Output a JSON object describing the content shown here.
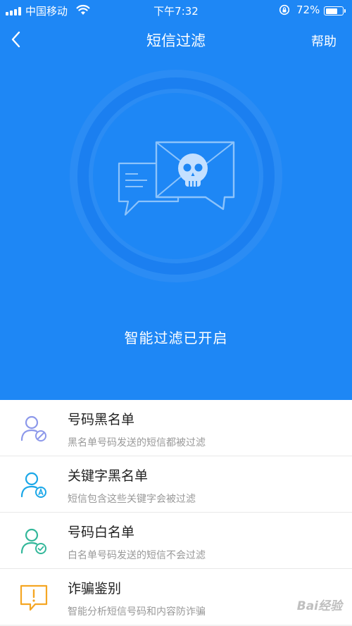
{
  "status_bar": {
    "carrier": "中国移动",
    "time": "下午7:32",
    "battery_percent": "72%",
    "battery_level": 0.72,
    "icons": [
      "signal-icon",
      "wifi-icon",
      "orientation-lock-icon",
      "battery-icon"
    ]
  },
  "nav": {
    "title": "短信过滤",
    "help_label": "帮助",
    "back_icon": "chevron-left-icon"
  },
  "hero": {
    "background_color": "#1e87f5",
    "graphic_icon": "spam-message-skull-icon",
    "status_text": "智能过滤已开启"
  },
  "list": {
    "items": [
      {
        "title": "号码黑名单",
        "subtitle": "黑名单号码发送的短信都被过滤",
        "icon": "user-blocked-icon"
      },
      {
        "title": "关键字黑名单",
        "subtitle": "短信包含这些关键字会被过滤",
        "icon": "user-keyword-icon"
      },
      {
        "title": "号码白名单",
        "subtitle": "白名单号码发送的短信不会过滤",
        "icon": "user-check-icon"
      },
      {
        "title": "诈骗鉴别",
        "subtitle": "智能分析短信号码和内容防诈骗",
        "icon": "fraud-alert-icon"
      }
    ]
  },
  "watermark": "Bai经验"
}
